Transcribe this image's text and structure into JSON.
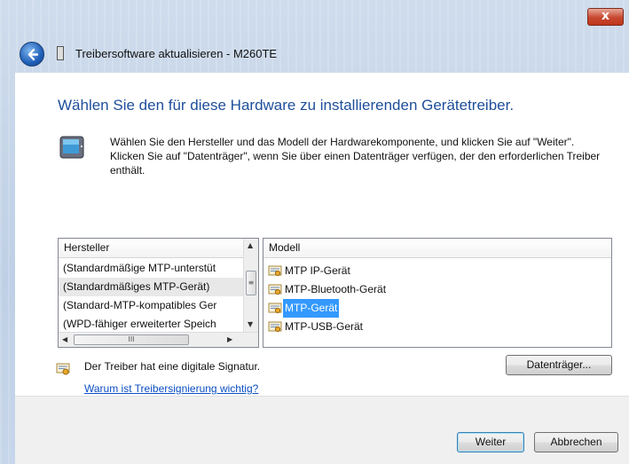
{
  "window": {
    "title": "Treibersoftware aktualisieren - M260TE",
    "close_glyph": "x"
  },
  "main": {
    "heading": "Wählen Sie den für diese Hardware zu installierenden Gerätetreiber.",
    "description": "Wählen Sie den Hersteller und das Modell der Hardwarekomponente, und klicken Sie auf \"Weiter\". Klicken Sie auf \"Datenträger\", wenn Sie über einen Datenträger verfügen, der den erforderlichen Treiber enthält."
  },
  "manufacturer_list": {
    "header": "Hersteller",
    "items": [
      "(Standardmäßige MTP-unterstüt",
      "(Standardmäßiges MTP-Gerät)",
      "(Standard-MTP-kompatibles Ger",
      "(WPD-fähiger erweiterter Speich"
    ],
    "selected_index": 1,
    "hscroll_glyph": "III",
    "vscroll_glyph": "≡"
  },
  "model_list": {
    "header": "Modell",
    "items": [
      "MTP IP-Gerät",
      "MTP-Bluetooth-Gerät",
      "MTP-Gerät",
      "MTP-USB-Gerät"
    ],
    "selected_index": 2
  },
  "signature": {
    "text": "Der Treiber hat eine digitale Signatur.",
    "link": "Warum ist Treibersignierung wichtig?"
  },
  "buttons": {
    "have_disk": "Datenträger...",
    "next": "Weiter",
    "cancel": "Abbrechen"
  },
  "colors": {
    "accent_heading": "#1e4e9a",
    "selection": "#3399ff",
    "link": "#0a4ec2"
  }
}
